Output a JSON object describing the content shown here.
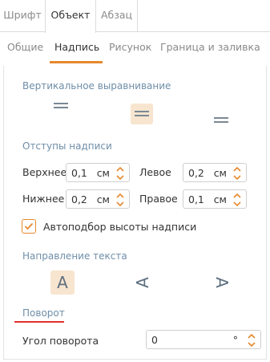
{
  "top_tabs": [
    {
      "label": "Шрифт",
      "active": false
    },
    {
      "label": "Объект",
      "active": true
    },
    {
      "label": "Абзац",
      "active": false
    }
  ],
  "sub_tabs": [
    {
      "label": "Общие",
      "active": false
    },
    {
      "label": "Надпись",
      "active": true
    },
    {
      "label": "Рисунок",
      "active": false
    },
    {
      "label": "Граница и заливка",
      "active": false
    }
  ],
  "vertical_alignment": {
    "title": "Вертикальное выравнивание",
    "options": [
      {
        "icon": "align-top-icon",
        "selected": false
      },
      {
        "icon": "align-middle-icon",
        "selected": true
      },
      {
        "icon": "align-bottom-icon",
        "selected": false
      }
    ]
  },
  "margins": {
    "title": "Отступы надписи",
    "fields": [
      {
        "label": "Верхнее",
        "value": "0,1",
        "unit": "см"
      },
      {
        "label": "Левое",
        "value": "0,2",
        "unit": "см"
      },
      {
        "label": "Нижнее",
        "value": "0,2",
        "unit": "см"
      },
      {
        "label": "Правое",
        "value": "0,1",
        "unit": "см"
      }
    ]
  },
  "autofit": {
    "label": "Автоподбор высоты надписи",
    "checked": true
  },
  "text_direction": {
    "title": "Направление текста",
    "options": [
      {
        "glyph": "A",
        "icon": "text-horizontal-icon",
        "selected": true
      },
      {
        "glyph": "A",
        "icon": "text-rotate-left-icon",
        "selected": false
      },
      {
        "glyph": "A",
        "icon": "text-rotate-right-icon",
        "selected": false
      }
    ]
  },
  "rotation": {
    "title": "Поворот",
    "angle_label": "Угол поворота",
    "angle_value": "0",
    "angle_unit": "°"
  },
  "colors": {
    "accent": "#e6882e",
    "accent_light": "#f8e5cf",
    "section_title": "#6f8ea9",
    "rotation_underline": "#e0302b"
  }
}
